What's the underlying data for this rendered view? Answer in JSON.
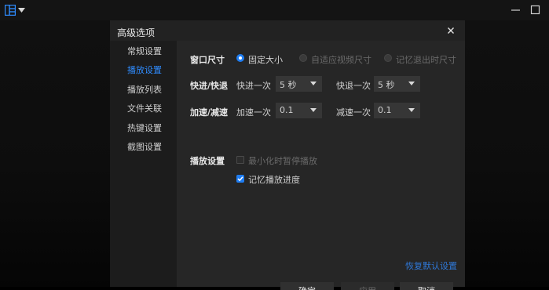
{
  "colors": {
    "accent": "#1f7df2",
    "link": "#2f78d8",
    "dialog_bg": "#222222",
    "nav_bg": "#1c1c1c"
  },
  "topbar": {
    "app_icon": "layout-grid-icon",
    "menu_icon": "caret-down-icon",
    "minimize_icon": "minimize-icon",
    "maximize_icon": "maximize-icon"
  },
  "dialog": {
    "title": "高级选项",
    "close_icon": "close-icon",
    "nav": [
      "常规设置",
      "播放设置",
      "播放列表",
      "文件关联",
      "热键设置",
      "截图设置"
    ],
    "active_nav_index": 1,
    "window_size": {
      "label": "窗口尺寸",
      "options": [
        "固定大小",
        "自适应视频尺寸",
        "记忆退出时尺寸"
      ],
      "selected_index": 0
    },
    "seek": {
      "label": "快进/快退",
      "forward_label": "快进一次",
      "forward_value": "5 秒",
      "backward_label": "快退一次",
      "backward_value": "5 秒"
    },
    "speed": {
      "label": "加速/减速",
      "up_label": "加速一次",
      "up_value": "0.1",
      "down_label": "减速一次",
      "down_value": "0.1"
    },
    "playback": {
      "label": "播放设置",
      "pause_on_minimize": {
        "label": "最小化时暂停播放",
        "checked": false
      },
      "remember_progress": {
        "label": "记忆播放进度",
        "checked": true
      }
    },
    "reset_link": "恢复默认设置",
    "buttons": {
      "ok": "确定",
      "apply": "应用",
      "cancel": "取消"
    }
  }
}
